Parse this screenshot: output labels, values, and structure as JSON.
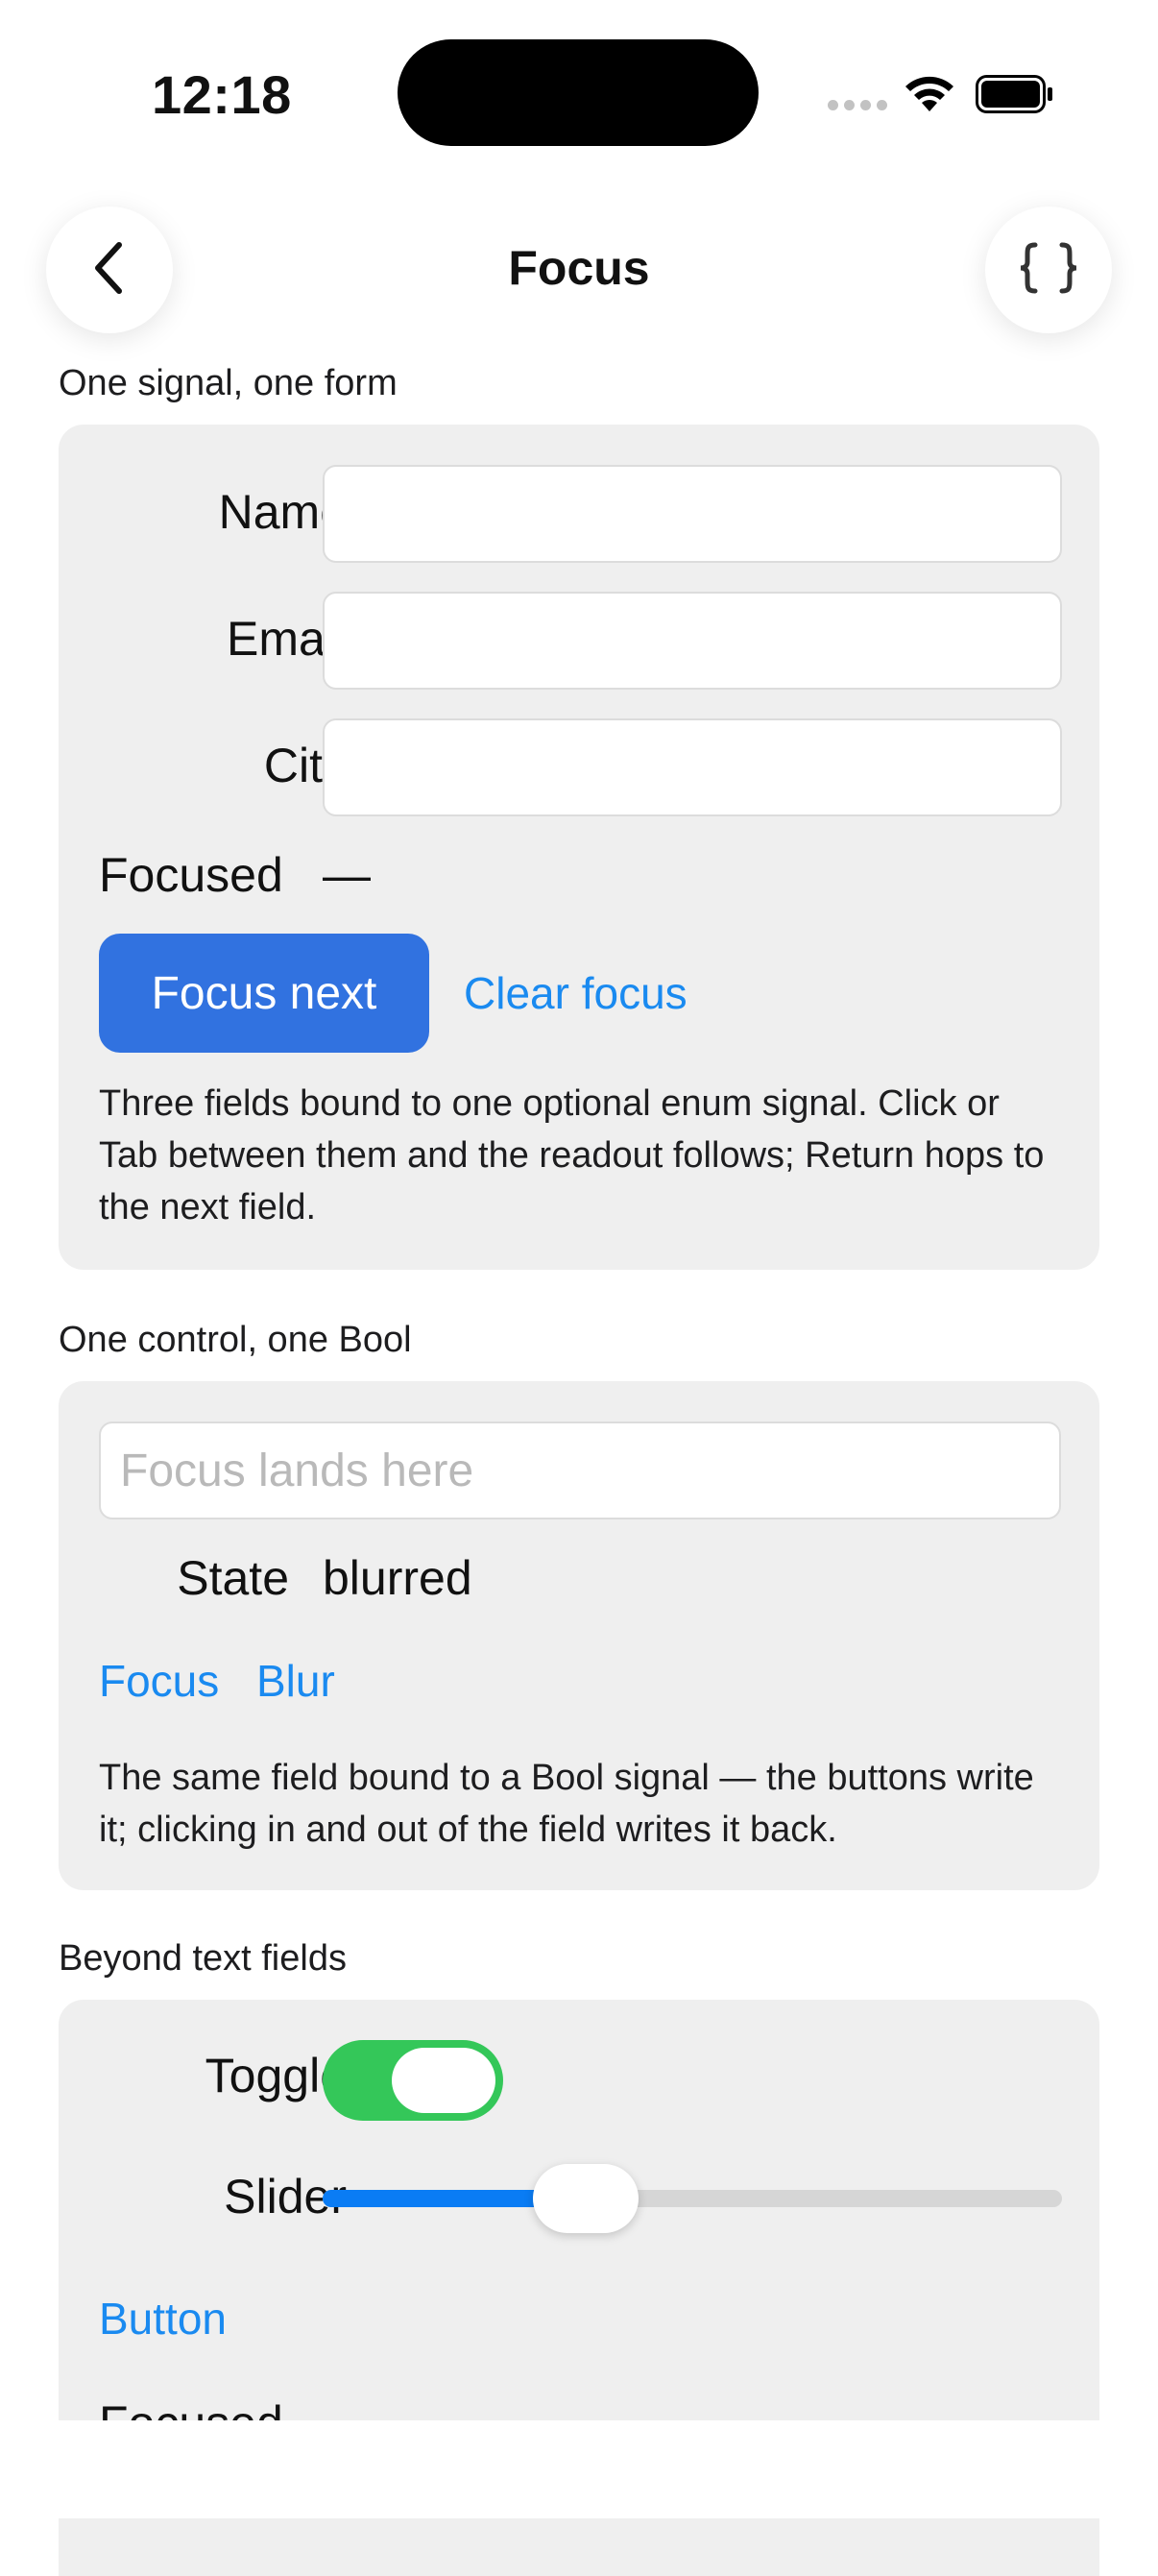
{
  "status_bar": {
    "time": "12:18"
  },
  "nav": {
    "title": "Focus",
    "back_icon": "chevron-left-icon",
    "code_icon": "braces-icon"
  },
  "section1": {
    "label": "One signal, one form",
    "fields": [
      {
        "label": "Name",
        "value": ""
      },
      {
        "label": "Email",
        "value": ""
      },
      {
        "label": "City",
        "value": ""
      }
    ],
    "focused_label": "Focused",
    "focused_value": "—",
    "focus_next_button": "Focus next",
    "clear_focus_link": "Clear focus",
    "description": "Three fields bound to one optional enum signal. Click or Tab between them and the readout follows; Return hops to the next field."
  },
  "section2": {
    "label": "One control, one Bool",
    "input_placeholder": "Focus lands here",
    "state_label": "State",
    "state_value": "blurred",
    "focus_link": "Focus",
    "blur_link": "Blur",
    "description": "The same field bound to a Bool signal — the buttons write it; clicking in and out of the field writes it back."
  },
  "section3": {
    "label": "Beyond text fields",
    "toggle_label": "Toggle",
    "toggle_on": true,
    "slider_label": "Slider",
    "slider_value": 0.33,
    "button_link": "Button",
    "focused_label": "Focused"
  },
  "colors": {
    "accent_link": "#1a8af0",
    "primary_button": "#3172e0",
    "toggle_on": "#34c759",
    "slider_fill": "#0a7cf4",
    "card_bg": "#efefef"
  }
}
